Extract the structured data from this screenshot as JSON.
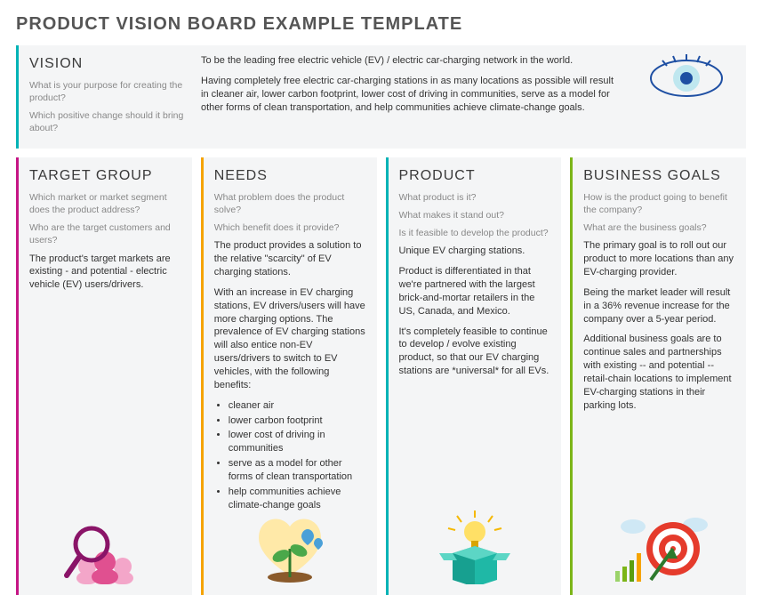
{
  "page_title": "PRODUCT VISION BOARD EXAMPLE TEMPLATE",
  "vision": {
    "title": "VISION",
    "q1": "What is your purpose for creating the product?",
    "q2": "Which positive change should it bring about?",
    "p1": "To be the leading free electric vehicle (EV) / electric car-charging network in the world.",
    "p2": "Having completely free electric car-charging stations in as many locations as possible will result in cleaner air, lower carbon footprint, lower cost of driving in communities, serve as a model for other forms of clean transportation, and help communities achieve climate-change goals."
  },
  "cols": {
    "target": {
      "title": "TARGET GROUP",
      "q1": "Which market or market segment does the product address?",
      "q2": "Who are the target customers and users?",
      "p1": "The product's target markets are existing - and potential - electric vehicle (EV) users/drivers."
    },
    "needs": {
      "title": "NEEDS",
      "q1": "What problem does the product solve?",
      "q2": "Which benefit does it provide?",
      "p1": "The product provides a solution to the relative \"scarcity\" of EV charging stations.",
      "p2": "With an increase in EV charging stations, EV drivers/users will have more charging options. The prevalence of EV charging stations will also entice non-EV users/drivers to switch to EV vehicles, with the following benefits:",
      "bullets": [
        "cleaner air",
        "lower carbon footprint",
        "lower cost of driving in communities",
        "serve as a model for other forms of clean transportation",
        "help communities achieve climate-change goals"
      ]
    },
    "product": {
      "title": "PRODUCT",
      "q1": "What product is it?",
      "q2": "What makes it stand out?",
      "q3": "Is it feasible to develop the product?",
      "p1": "Unique EV charging stations.",
      "p2": "Product is differentiated in that we're partnered with the largest brick-and-mortar retailers in the US, Canada, and Mexico.",
      "p3": "It's completely feasible to continue to develop / evolve existing product, so that our EV charging stations are *universal* for all EVs."
    },
    "goals": {
      "title": "BUSINESS GOALS",
      "q1": "How is the product going to benefit the company?",
      "q2": "What are the business goals?",
      "p1": "The primary goal is to roll out our product to more locations than any EV-charging provider.",
      "p2": "Being the market leader will result in a 36% revenue increase for the company over a 5-year period.",
      "p3": "Additional business goals are to continue sales and partnerships with existing -- and potential -- retail-chain locations to implement EV-charging stations in their parking lots."
    }
  }
}
